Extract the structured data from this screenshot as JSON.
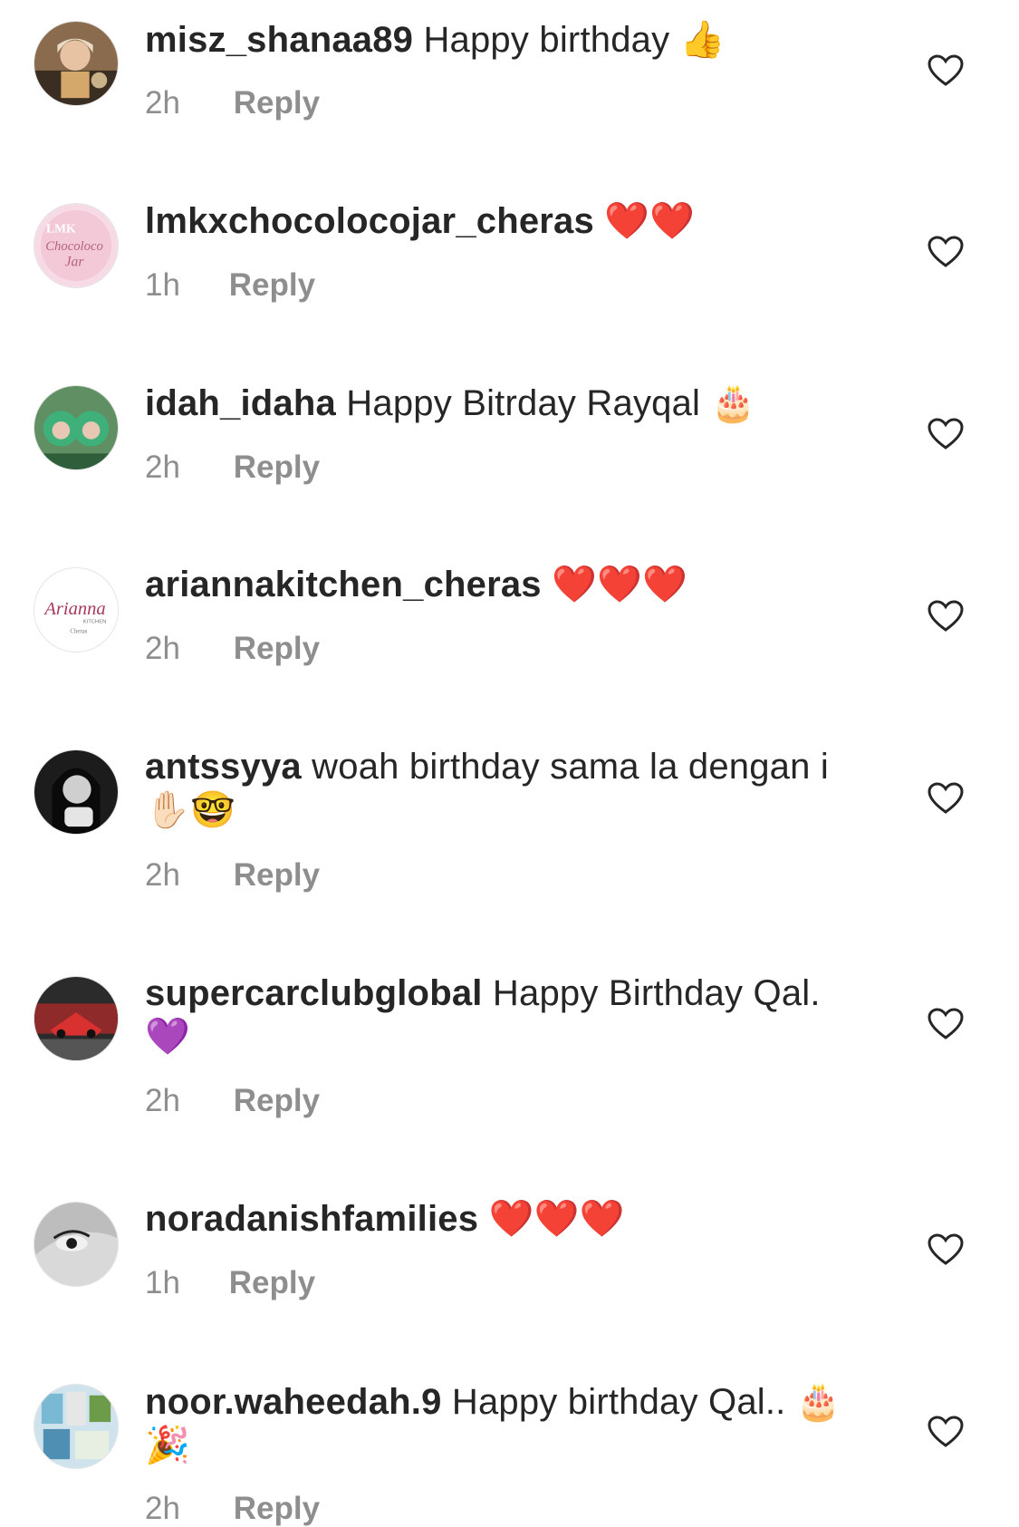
{
  "comments": [
    {
      "username": "misz_shanaa89",
      "text": "Happy birthday",
      "emoji": "👍",
      "time": "2h",
      "reply": "Reply"
    },
    {
      "username": "lmkxchocolocojar_cheras",
      "text": "",
      "emoji": "❤️❤️",
      "time": "1h",
      "reply": "Reply",
      "avatar_text": {
        "line1": "LMK",
        "line2": "Chocoloco",
        "line3": "Jar"
      }
    },
    {
      "username": "idah_idaha",
      "text": "Happy Bitrday Rayqal",
      "emoji": "🎂",
      "time": "2h",
      "reply": "Reply"
    },
    {
      "username": "ariannakitchen_cheras",
      "text": "",
      "emoji": "❤️❤️❤️",
      "time": "2h",
      "reply": "Reply",
      "avatar_text": {
        "line1": "Arianna",
        "line2": "KITCHEN",
        "line3": "Cheras"
      }
    },
    {
      "username": "antssyya",
      "text": "woah birthday sama la dengan i",
      "emoji": "✋🏻🤓",
      "time": "2h",
      "reply": "Reply"
    },
    {
      "username": "supercarclubglobal",
      "text": "Happy Birthday Qal.",
      "emoji": "💜",
      "time": "2h",
      "reply": "Reply"
    },
    {
      "username": "noradanishfamilies",
      "text": "",
      "emoji": "❤️❤️❤️",
      "time": "1h",
      "reply": "Reply"
    },
    {
      "username": "noor.waheedah.9",
      "text": "Happy birthday Qal..",
      "emoji": "🎂🎉",
      "time": "2h",
      "reply": "Reply"
    }
  ],
  "colors": {
    "text": "#262626",
    "secondary": "#8e8e8e",
    "heart_icon": "#262626"
  },
  "icons": {
    "like": "heart-outline-icon"
  }
}
